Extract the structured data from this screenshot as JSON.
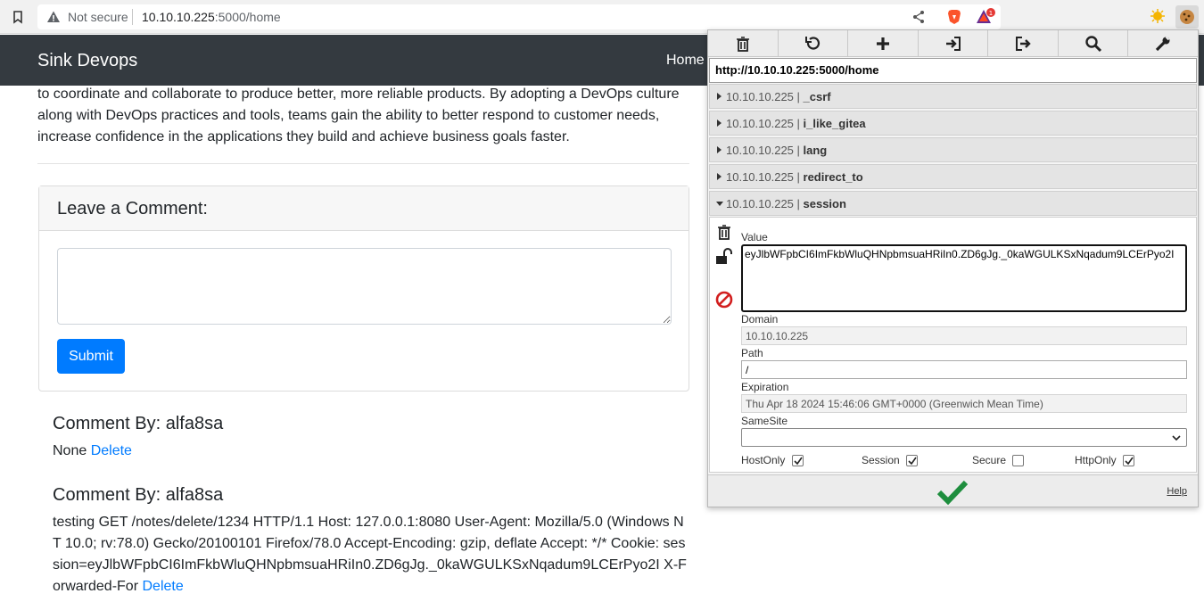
{
  "browser": {
    "not_secure": "Not secure",
    "url_host": "10.10.10.225",
    "url_rest": ":5000/home",
    "notification_count": "1"
  },
  "navbar": {
    "brand": "Sink Devops",
    "home": "Home"
  },
  "content": {
    "intro": "to coordinate and collaborate to produce better, more reliable products. By adopting a DevOps culture along with DevOps practices and tools, teams gain the ability to better respond to customer needs, increase confidence in the applications they build and achieve business goals faster.",
    "comment_form": {
      "title": "Leave a Comment:",
      "textarea_value": "",
      "submit_label": "Submit"
    },
    "comments": [
      {
        "head": "Comment By: alfa8sa",
        "body": "None",
        "delete_label": "Delete"
      },
      {
        "head": "Comment By: alfa8sa",
        "body": "testing GET /notes/delete/1234 HTTP/1.1 Host: 127.0.0.1:8080 User-Agent: Mozilla/5.0 (Windows NT 10.0; rv:78.0) Gecko/20100101 Firefox/78.0 Accept-Encoding: gzip, deflate Accept: */* Cookie: session=eyJlbWFpbCI6ImFkbWluQHNpbmsuaHRiIn0.ZD6gJg._0kaWGULKSxNqadum9LCErPyo2I X-Forwarded-For",
        "delete_label": "Delete"
      }
    ]
  },
  "cookie_editor": {
    "toolbar_icons": [
      "trash-icon",
      "undo-icon",
      "plus-icon",
      "import-icon",
      "export-icon",
      "search-icon",
      "wrench-icon"
    ],
    "url": "http://10.10.10.225:5000/home",
    "cookies": [
      {
        "domain": "10.10.10.225 | ",
        "name": "_csrf"
      },
      {
        "domain": "10.10.10.225 | ",
        "name": "i_like_gitea"
      },
      {
        "domain": "10.10.10.225 | ",
        "name": "lang"
      },
      {
        "domain": "10.10.10.225 | ",
        "name": "redirect_to"
      },
      {
        "domain": "10.10.10.225 | ",
        "name": "session"
      }
    ],
    "detail": {
      "value_label": "Value",
      "value": "eyJlbWFpbCI6ImFkbWluQHNpbmsuaHRiIn0.ZD6gJg._0kaWGULKSxNqadum9LCErPyo2I",
      "domain_label": "Domain",
      "domain": "10.10.10.225",
      "path_label": "Path",
      "path": "/",
      "expiration_label": "Expiration",
      "expiration": "Thu Apr 18 2024 15:46:06 GMT+0000 (Greenwich Mean Time)",
      "samesite_label": "SameSite",
      "samesite_value": "",
      "flags": [
        {
          "label": "HostOnly",
          "checked": true
        },
        {
          "label": "Session",
          "checked": true
        },
        {
          "label": "Secure",
          "checked": false
        },
        {
          "label": "HttpOnly",
          "checked": true
        }
      ]
    },
    "help": "Help",
    "colors": {
      "save_green": "#1e8e3e",
      "delete_red": "#d21f1f"
    }
  }
}
